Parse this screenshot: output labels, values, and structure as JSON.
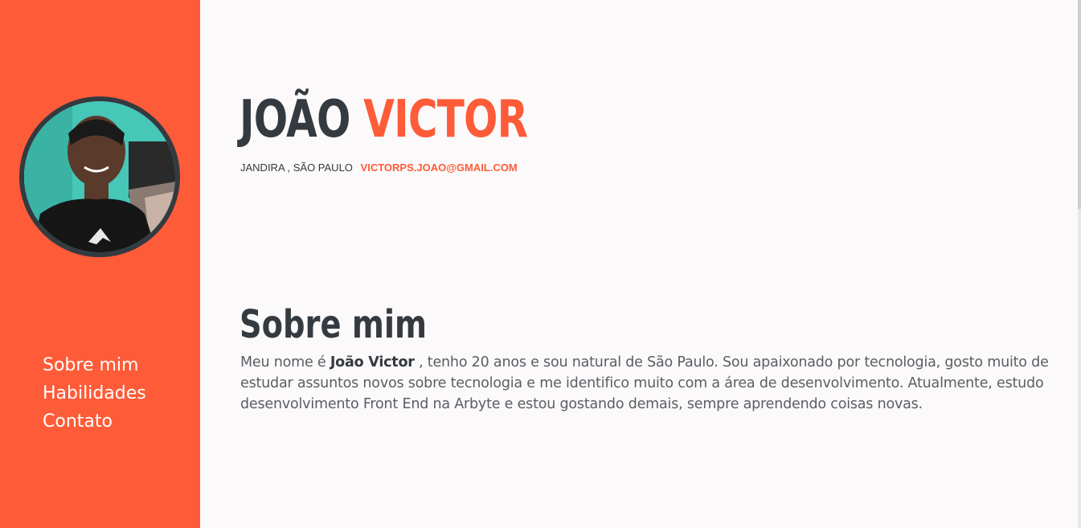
{
  "sidebar": {
    "avatar_alt": "Foto de perfil",
    "nav": [
      {
        "label": "Sobre mim"
      },
      {
        "label": "Habilidades"
      },
      {
        "label": "Contato"
      }
    ]
  },
  "header": {
    "first_name": "JOÃO",
    "last_name": "VICTOR",
    "location": "JANDIRA , SÃO PAULO",
    "email": "VICTORPS.JOAO@GMAIL.COM"
  },
  "about": {
    "title": "Sobre mim",
    "text_before": "Meu nome é ",
    "highlight_name": "João Victor",
    "text_after": " , tenho 20 anos e sou natural de São Paulo. Sou apaixonado por tecnologia, gosto muito de estudar assuntos novos sobre tecnologia e me identifico muito com a área de desenvolvimento. Atualmente, estudo desenvolvimento Front End na Arbyte e estou gostando demais, sempre aprendendo coisas novas."
  },
  "colors": {
    "accent": "#fe5b38",
    "dark": "#343a40",
    "background": "#fbf9fa"
  }
}
